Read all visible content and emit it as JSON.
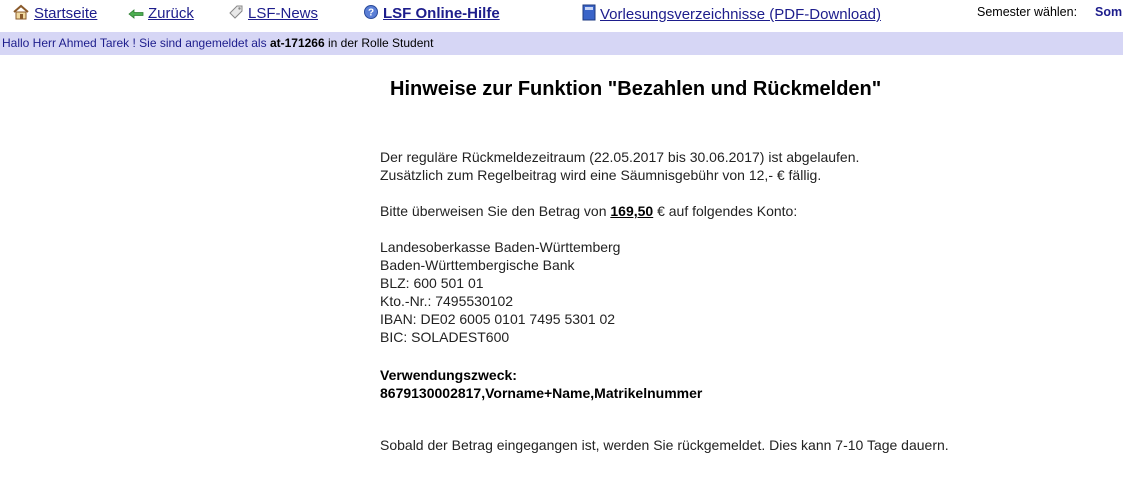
{
  "nav": {
    "startseite": "Startseite",
    "zurueck": "Zurück",
    "lsf_news": "LSF-News",
    "online_hilfe": "LSF Online-Hilfe",
    "vorlesungsverzeichnisse": "Vorlesungsverzeichnisse (PDF-Download)",
    "semester_label": "Semester wählen:",
    "semester_value": "Som"
  },
  "userbar": {
    "greeting": "Hallo Herr Ahmed Tarek ! Sie sind angemeldet als",
    "user_id": "at-171266",
    "role_text": "in der Rolle Student"
  },
  "main": {
    "title": "Hinweise zur Funktion \"Bezahlen und Rückmelden\"",
    "line1": "Der reguläre Rückmeldezeitraum (22.05.2017 bis 30.06.2017) ist abgelaufen.",
    "line2": "Zusätzlich zum Regelbeitrag wird eine Säumnisgebühr von 12,- € fällig.",
    "pay_prefix": "Bitte überweisen Sie den Betrag von",
    "amount": "169,50",
    "pay_suffix": "€ auf folgendes Konto:",
    "bank": {
      "recipient": "Landesoberkasse Baden-Württemberg",
      "bank_name": "Baden-Württembergische Bank",
      "blz": "BLZ: 600 501 01",
      "kto": "Kto.-Nr.: 7495530102",
      "iban": "IBAN: DE02 6005 0101 7495 5301 02",
      "bic": "BIC: SOLADEST600"
    },
    "purpose_label": "Verwendungszweck:",
    "purpose_value": "8679130002817,Vorname+Name,Matrikelnummer",
    "final_note": "Sobald der Betrag eingegangen ist, werden Sie rückgemeldet. Dies kann 7-10 Tage dauern."
  }
}
